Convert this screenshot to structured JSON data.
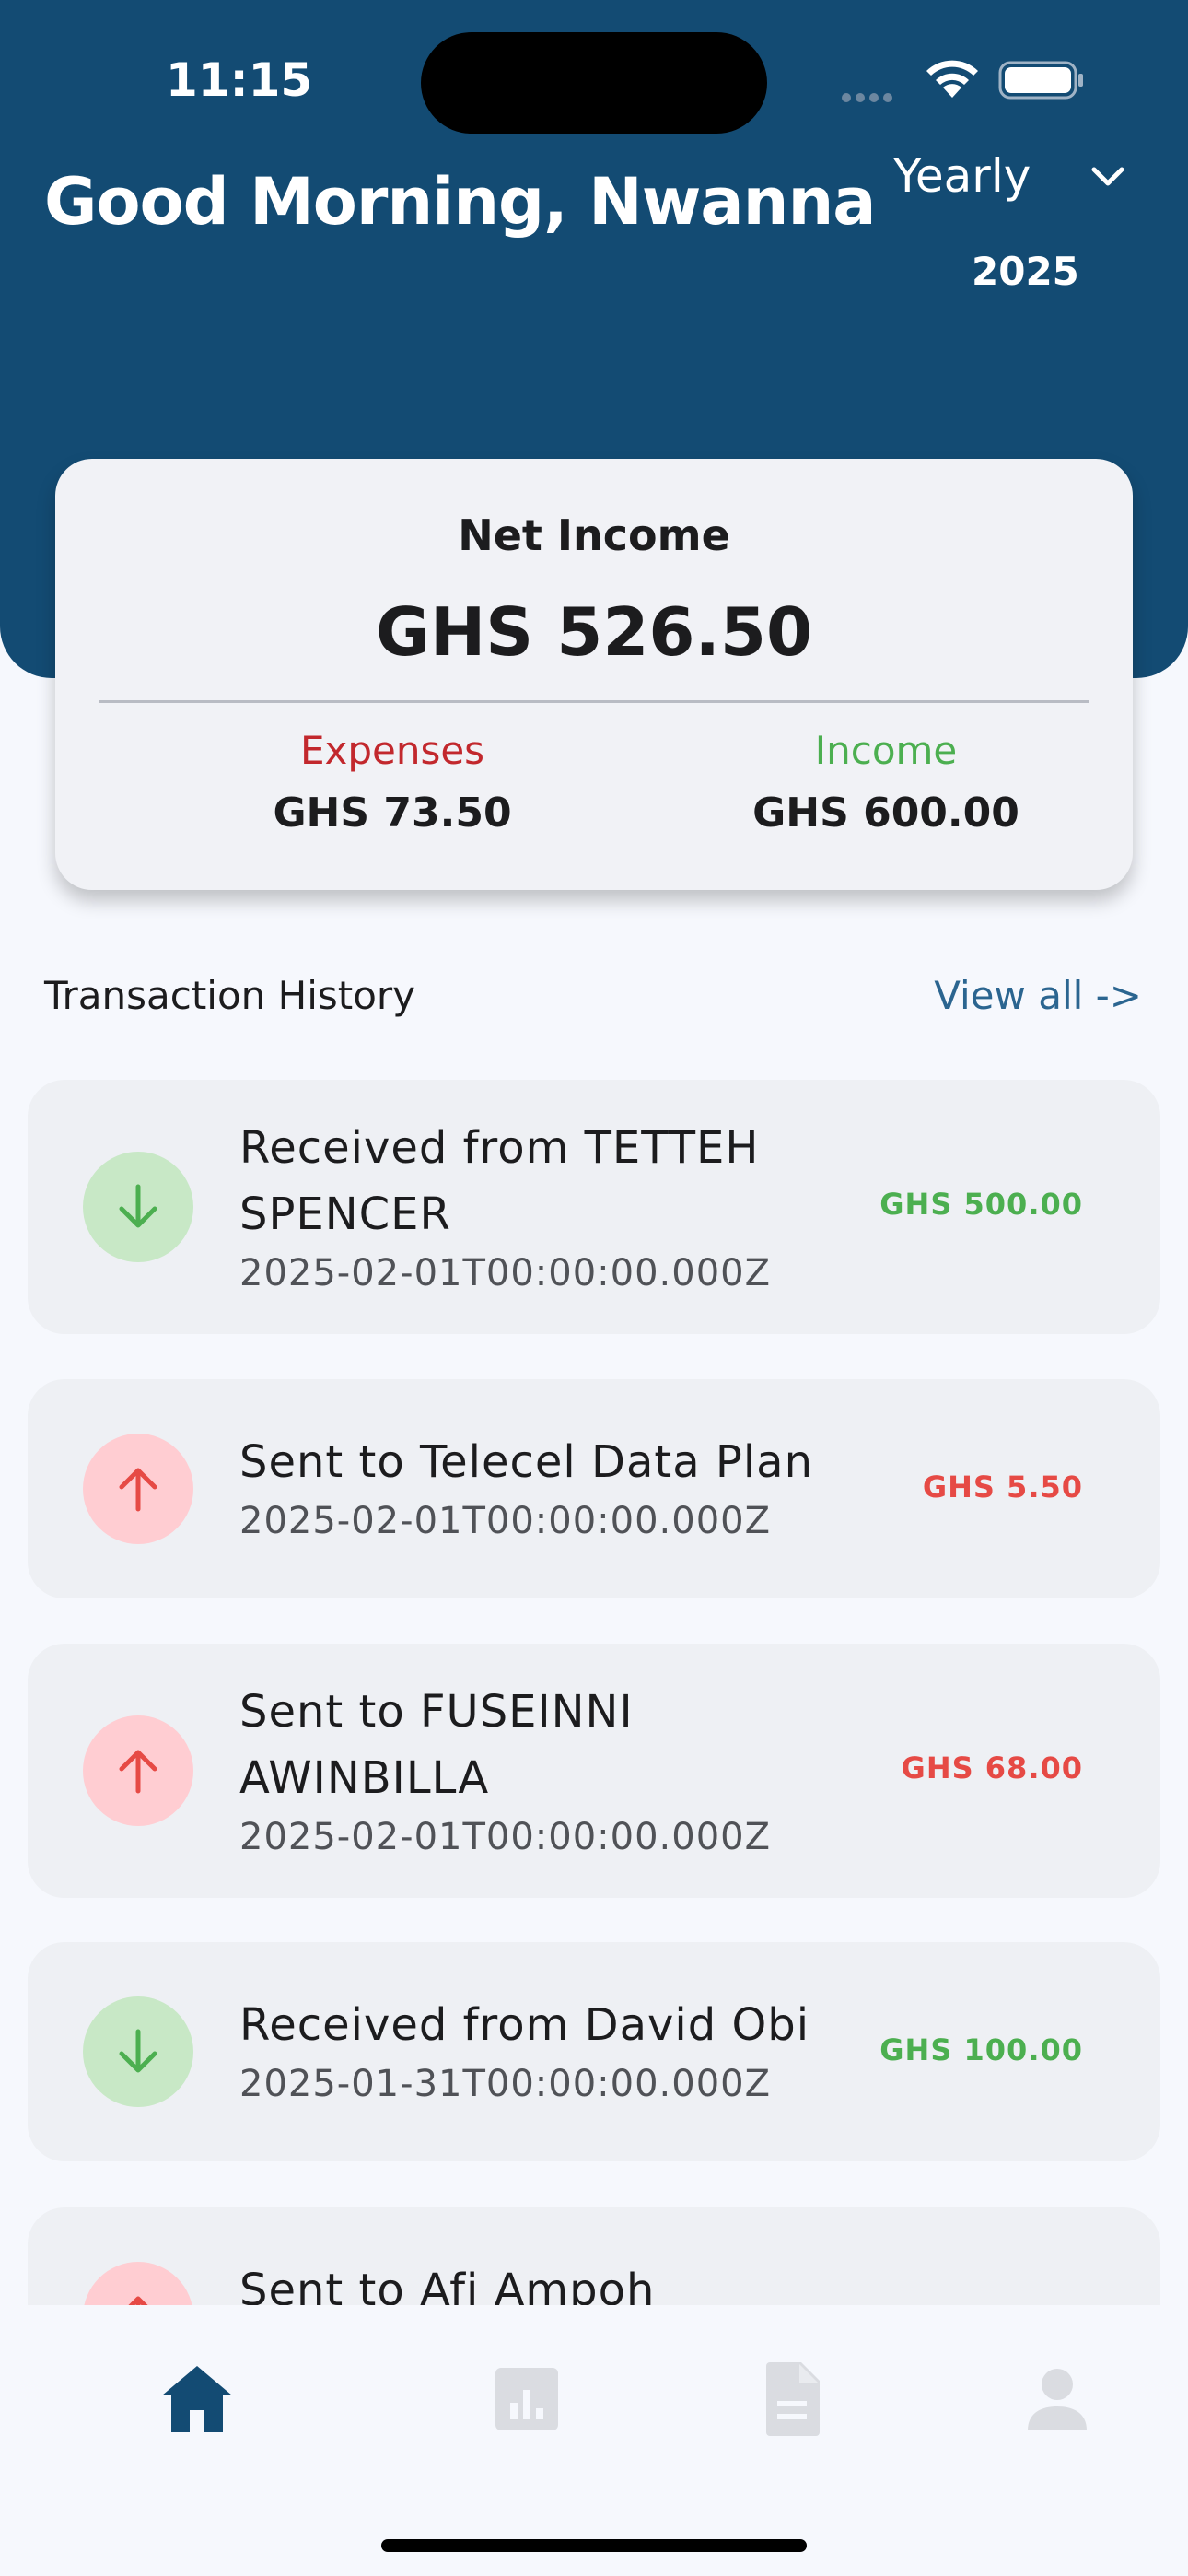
{
  "status_bar": {
    "time": "11:15"
  },
  "header": {
    "greeting": "Good Morning, Nwanna",
    "period": "Yearly",
    "year": "2025"
  },
  "summary": {
    "net_label": "Net Income",
    "net_value": "GHS 526.50",
    "expenses_label": "Expenses",
    "expenses_value": "GHS 73.50",
    "income_label": "Income",
    "income_value": "GHS 600.00"
  },
  "history": {
    "title": "Transaction History",
    "view_all": "View all ->",
    "transactions": [
      {
        "type": "in",
        "title": "Received from TETTEH SPENCER",
        "date": "2025-02-01T00:00:00.000Z",
        "amount": "GHS 500.00"
      },
      {
        "type": "out",
        "title": "Sent to Telecel Data Plan",
        "date": "2025-02-01T00:00:00.000Z",
        "amount": "GHS 5.50"
      },
      {
        "type": "out",
        "title": "Sent to FUSEINNI AWINBILLA",
        "date": "2025-02-01T00:00:00.000Z",
        "amount": "GHS 68.00"
      },
      {
        "type": "in",
        "title": "Received from David Obi",
        "date": "2025-01-31T00:00:00.000Z",
        "amount": "GHS 100.00"
      },
      {
        "type": "out",
        "title": "Sent to Afi Ampoh",
        "date": "",
        "amount": ""
      }
    ]
  },
  "tab_bar": {
    "tabs": [
      {
        "icon": "home-icon",
        "active": true
      },
      {
        "icon": "analytics-icon",
        "active": false
      },
      {
        "icon": "document-icon",
        "active": false
      },
      {
        "icon": "profile-icon",
        "active": false
      }
    ]
  },
  "colors": {
    "header_bg": "#134b73",
    "income_green": "#4caf50",
    "expense_red": "#e64a45",
    "active_tab": "#134b73",
    "inactive_tab": "#dadce1"
  }
}
